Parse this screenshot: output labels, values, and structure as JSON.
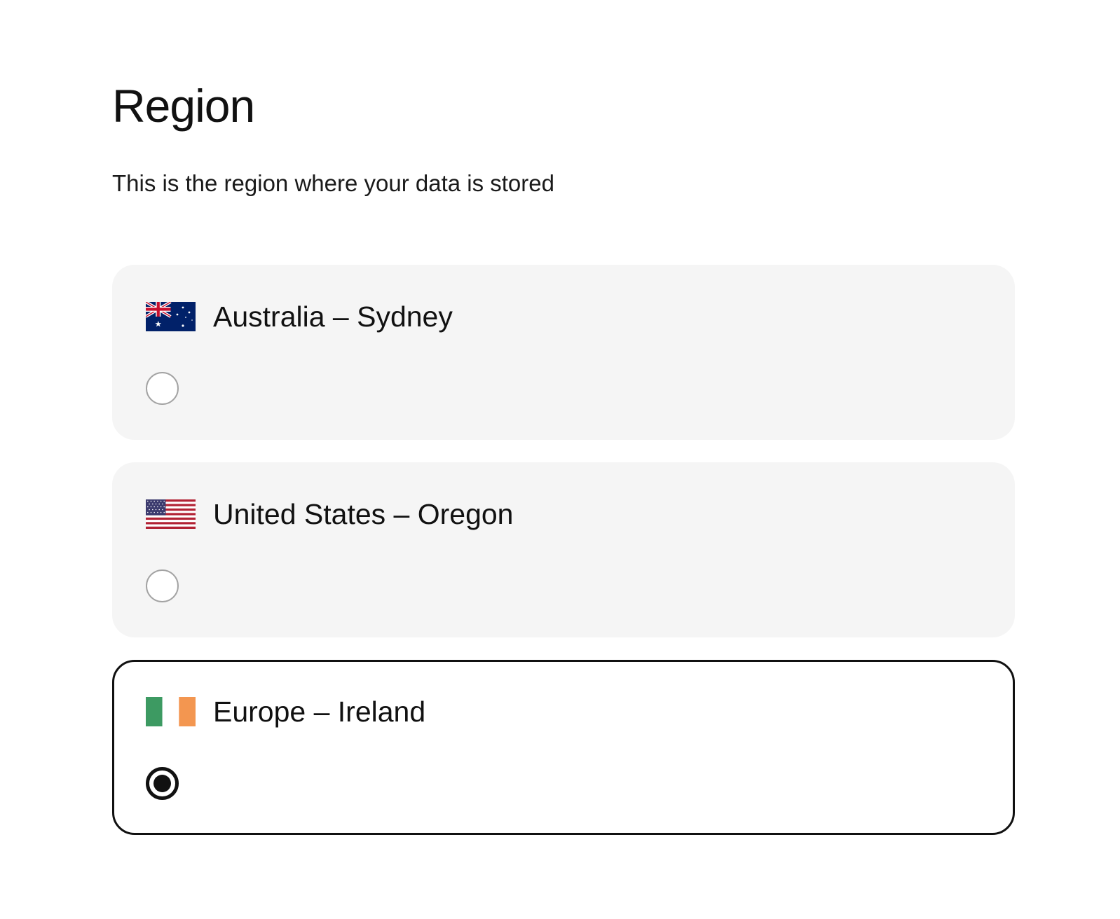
{
  "header": {
    "title": "Region",
    "subtitle": "This is the region where your data is stored"
  },
  "regions": [
    {
      "label": "Australia – Sydney",
      "flag_icon": "australia-flag-icon",
      "selected": false
    },
    {
      "label": "United States – Oregon",
      "flag_icon": "united-states-flag-icon",
      "selected": false
    },
    {
      "label": "Europe – Ireland",
      "flag_icon": "ireland-flag-icon",
      "selected": true
    }
  ],
  "colors": {
    "card_background": "#f5f5f5",
    "selected_border": "#111111",
    "radio_border": "#a3a3a3",
    "australia_blue": "#012169",
    "us_red": "#b22234",
    "us_blue": "#3c3b6e",
    "ireland_green": "#3d9a62",
    "ireland_orange": "#f39650"
  }
}
